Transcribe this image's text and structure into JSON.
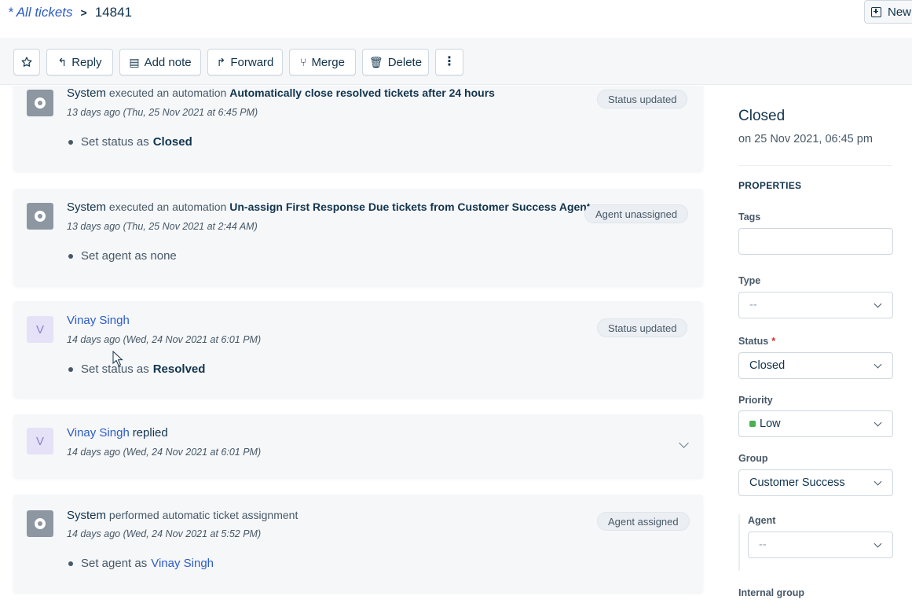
{
  "header": {
    "breadcrumb_link": "* All tickets",
    "breadcrumb_sep": ">",
    "ticket_id": "14841",
    "new_label": "New"
  },
  "toolbar": {
    "reply": "Reply",
    "add_note": "Add note",
    "forward": "Forward",
    "merge": "Merge",
    "delete": "Delete"
  },
  "activities": [
    {
      "actor": "System",
      "action": "executed an automation",
      "target": "Automatically close resolved tickets after 24 hours",
      "time": "13 days ago (Thu, 25 Nov 2021 at 6:45 PM)",
      "bullet_prefix": "Set status as",
      "bullet_value": "Closed",
      "badge": "Status updated"
    },
    {
      "actor": "System",
      "action": "executed an automation",
      "target": "Un-assign First Response Due tickets from Customer Success Agent",
      "time": "13 days ago (Thu, 25 Nov 2021 at 2:44 AM)",
      "bullet_prefix": "Set agent as none",
      "badge": "Agent unassigned"
    },
    {
      "avatar": "V",
      "actor": "Vinay Singh",
      "time": "14 days ago (Wed, 24 Nov 2021 at 6:01 PM)",
      "bullet_prefix": "Set status as",
      "bullet_value": "Resolved",
      "badge": "Status updated"
    },
    {
      "avatar": "V",
      "actor": "Vinay Singh",
      "action": "replied",
      "time": "14 days ago (Wed, 24 Nov 2021 at 6:01 PM)"
    },
    {
      "actor": "System",
      "action": "performed automatic ticket assignment",
      "time": "14 days ago (Wed, 24 Nov 2021 at 5:52 PM)",
      "bullet_prefix": "Set agent as",
      "bullet_value": "Vinay Singh",
      "badge": "Agent assigned"
    }
  ],
  "sidebar": {
    "status": "Closed",
    "date": "on 25 Nov 2021, 06:45 pm",
    "heading": "PROPERTIES",
    "tags_label": "Tags",
    "type_label": "Type",
    "type_value": "--",
    "status_label": "Status",
    "required_mark": "*",
    "status_value": "Closed",
    "priority_label": "Priority",
    "priority_value": "Low",
    "priority_color": "#4caf50",
    "group_label": "Group",
    "group_value": "Customer Success",
    "agent_label": "Agent",
    "agent_value": "--",
    "internal_group_label": "Internal group"
  },
  "colors": {
    "link": "#2c5cc5",
    "text": "#12344d",
    "card_bg": "#f5f7f9"
  }
}
